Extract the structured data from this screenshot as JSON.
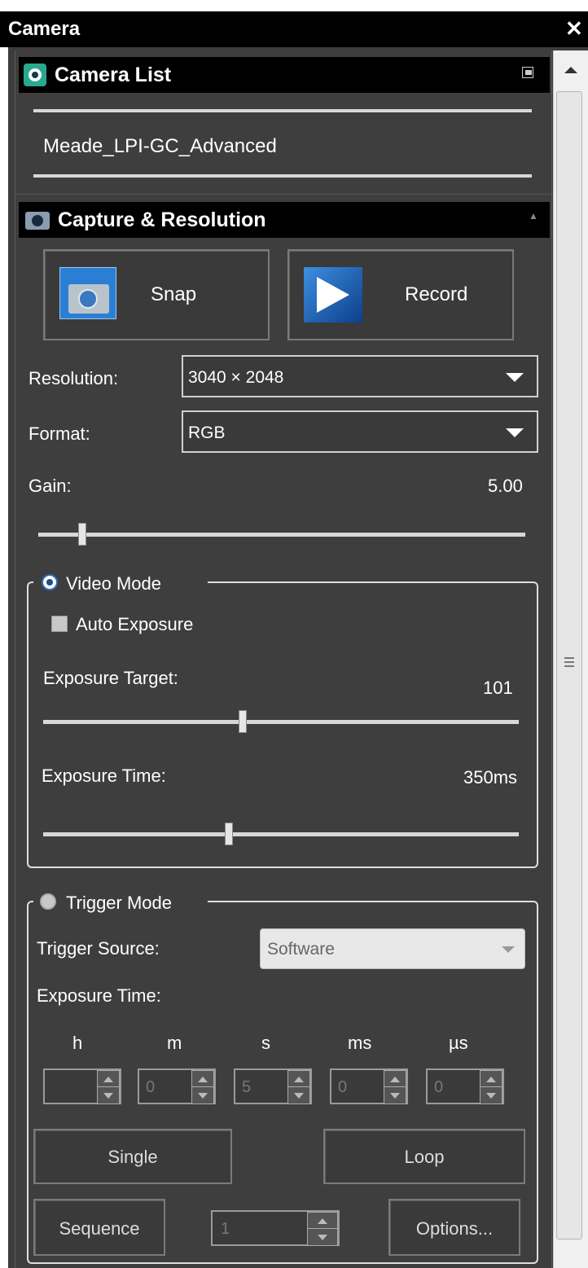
{
  "window": {
    "title": "Camera",
    "close_glyph": "✕"
  },
  "camera_list": {
    "title": "Camera List",
    "icon": "camera-lens-icon",
    "collapse_glyph": "▣",
    "items": [
      "Meade_LPI-GC_Advanced"
    ]
  },
  "capture": {
    "title": "Capture & Resolution",
    "collapse_glyph": "▲",
    "snap_label": "Snap",
    "record_label": "Record",
    "resolution_label": "Resolution:",
    "resolution_value": "3040 × 2048",
    "format_label": "Format:",
    "format_value": "RGB",
    "gain_label": "Gain:",
    "gain_value": "5.00",
    "gain_slider_fraction": 0.09
  },
  "video_mode": {
    "label": "Video Mode",
    "selected": true,
    "auto_exposure_label": "Auto Exposure",
    "auto_exposure_checked": false,
    "exposure_target_label": "Exposure Target:",
    "exposure_target_value": "101",
    "exposure_target_fraction": 0.42,
    "exposure_time_label": "Exposure Time:",
    "exposure_time_value": "350ms",
    "exposure_time_fraction": 0.39
  },
  "trigger_mode": {
    "label": "Trigger Mode",
    "selected": false,
    "trigger_source_label": "Trigger Source:",
    "trigger_source_value": "Software",
    "exposure_time_label": "Exposure Time:",
    "units": [
      "h",
      "m",
      "s",
      "ms",
      "µs"
    ],
    "values": [
      "",
      "0",
      "5",
      "0",
      "0"
    ],
    "single_label": "Single",
    "loop_label": "Loop",
    "sequence_label": "Sequence",
    "sequence_count": "1",
    "options_label": "Options..."
  },
  "colors": {
    "header": "#000000",
    "panel": "#3e3e3e",
    "accent": "#2a7fd4"
  }
}
